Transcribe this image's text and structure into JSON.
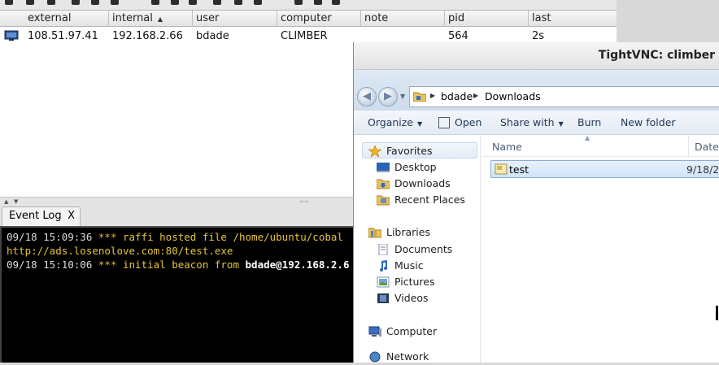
{
  "colors": {
    "console_bg": "#000000",
    "console_text": "#dcdcdc",
    "console_accent": "#e6c53a",
    "explorer_selection": "#cfe3f8",
    "explorer_link": "#1e395b"
  },
  "sessions_table": {
    "columns": [
      {
        "label": "external"
      },
      {
        "label": "internal",
        "sort_indicator": "▲"
      },
      {
        "label": "user"
      },
      {
        "label": "computer"
      },
      {
        "label": "note"
      },
      {
        "label": "pid"
      },
      {
        "label": "last"
      }
    ],
    "rows": [
      {
        "icon": "beacon-session-icon",
        "external": "108.51.97.41",
        "internal": "192.168.2.66",
        "user": "bdade",
        "computer": "CLIMBER",
        "note": "",
        "pid": "564",
        "last": "2s"
      }
    ]
  },
  "bottom_tabs": [
    {
      "label": "Event Log",
      "close": "X"
    }
  ],
  "event_log": {
    "line1_time": "09/18 15:09:36",
    "line1_stars": "***",
    "line1_text": "raffi hosted file /home/ubuntu/cobal",
    "line2_text": "http://ads.losenolove.com:80/test.exe",
    "line3_time": "09/18 15:10:06",
    "line3_stars": "***",
    "line3_text": "initial beacon from",
    "line3_user": "bdade@192.168.2.6"
  },
  "vnc": {
    "title": "TightVNC: climber",
    "breadcrumb": [
      "bdade",
      "Downloads"
    ],
    "commands": {
      "organize": "Organize",
      "open": "Open",
      "share_with": "Share with",
      "burn": "Burn",
      "new_folder": "New folder"
    },
    "nav_pane": {
      "favorites": "Favorites",
      "desktop": "Desktop",
      "downloads": "Downloads",
      "recent_places": "Recent Places",
      "libraries": "Libraries",
      "documents": "Documents",
      "music": "Music",
      "pictures": "Pictures",
      "videos": "Videos",
      "computer": "Computer",
      "network": "Network"
    },
    "columns": {
      "name": "Name",
      "date": "Date m"
    },
    "files": [
      {
        "name": "test",
        "date": "9/18/2"
      }
    ]
  }
}
